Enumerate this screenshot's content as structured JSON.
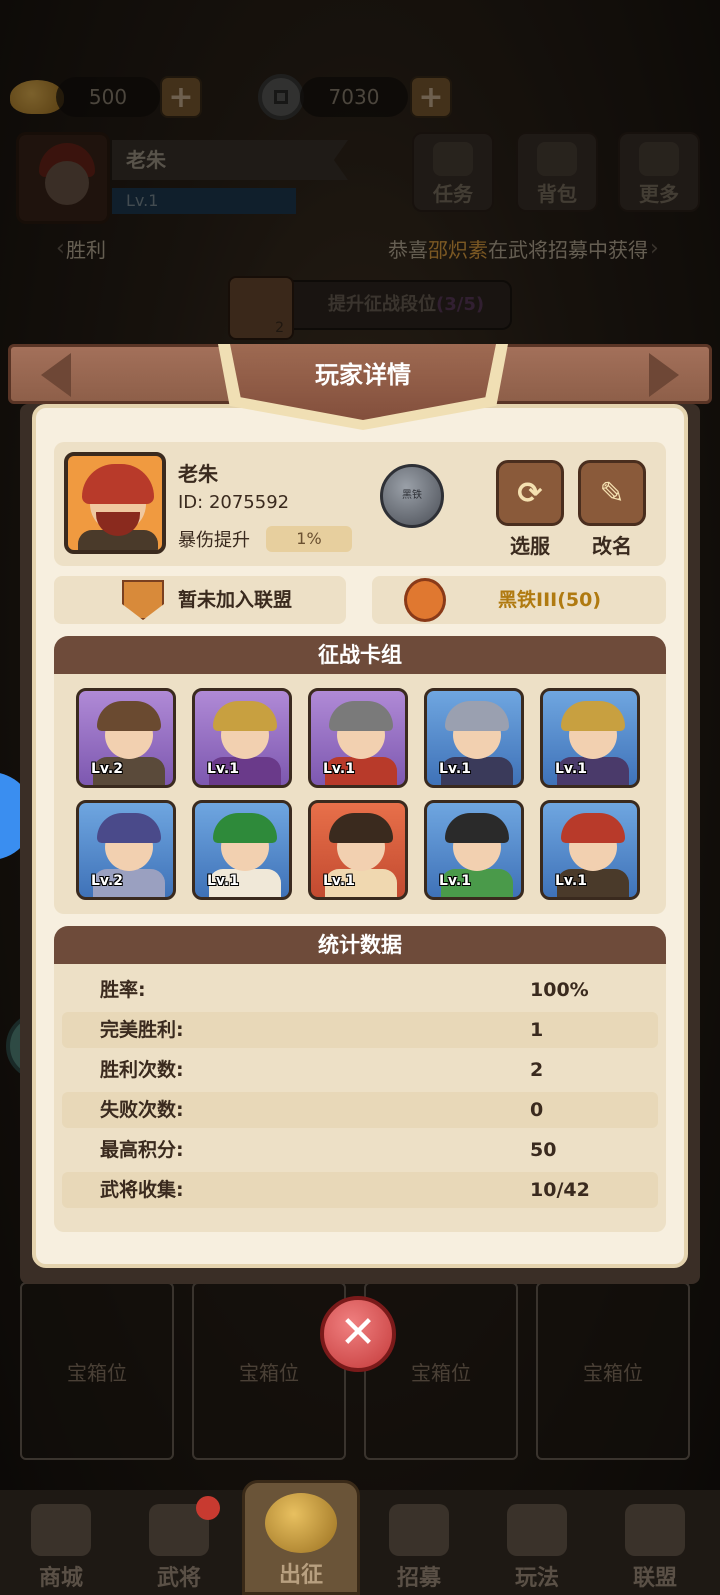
{
  "top_bar": {
    "gold_amount": "500",
    "coin_amount": "7030",
    "plus_label": "+"
  },
  "header": {
    "player_name": "老朱",
    "player_level": "Lv.1",
    "buttons": [
      {
        "label": "任务",
        "icon": "scroll-icon"
      },
      {
        "label": "背包",
        "icon": "bag-icon"
      },
      {
        "label": "更多",
        "icon": "menu-icon"
      }
    ]
  },
  "ticker": {
    "left_text": "胜利",
    "right_prefix": "恭喜",
    "right_name": "邵炽素",
    "right_suffix": "在武将招募中获得",
    "left_arrow": "‹",
    "right_arrow": "›"
  },
  "rank_button": {
    "label": "提升征战段位",
    "progress": "(3/5)",
    "count": "2"
  },
  "panel": {
    "title": "玩家详情",
    "player": {
      "name": "老朱",
      "id": "ID: 2075592",
      "crit_label": "暴伤提升",
      "crit_value": "1%",
      "rank_medal_text": "黑铁"
    },
    "actions": {
      "select_server": "选服",
      "rename": "改名"
    },
    "alliance": "暂未加入联盟",
    "rank": "黑铁III(50)",
    "deck": {
      "title": "征战卡组",
      "heroes": [
        {
          "level": "Lv.2",
          "color": "purple",
          "hair": "#6a4a30",
          "outfit": "#5a4a3a"
        },
        {
          "level": "Lv.1",
          "color": "purple",
          "hair": "#c8a040",
          "outfit": "#6a3a8a"
        },
        {
          "level": "Lv.1",
          "color": "purple",
          "hair": "#7a7a7a",
          "outfit": "#b83a2a"
        },
        {
          "level": "Lv.1",
          "color": "blue",
          "hair": "#9aa0b0",
          "outfit": "#3a3a5a"
        },
        {
          "level": "Lv.1",
          "color": "blue",
          "hair": "#c8a040",
          "outfit": "#4a3a6a"
        },
        {
          "level": "Lv.2",
          "color": "blue",
          "hair": "#4a4a8a",
          "outfit": "#9aa0c0"
        },
        {
          "level": "Lv.1",
          "color": "blue",
          "hair": "#2e8a3a",
          "outfit": "#f0e8d8"
        },
        {
          "level": "Lv.1",
          "color": "red",
          "hair": "#3a2a1e",
          "outfit": "#f0d8b0"
        },
        {
          "level": "Lv.1",
          "color": "blue",
          "hair": "#2a2a2a",
          "outfit": "#4a9a4a"
        },
        {
          "level": "Lv.1",
          "color": "blue",
          "hair": "#b83a2a",
          "outfit": "#4a3a2a"
        }
      ]
    },
    "stats": {
      "title": "统计数据",
      "rows": [
        {
          "label": "胜率:",
          "value": "100%"
        },
        {
          "label": "完美胜利:",
          "value": "1"
        },
        {
          "label": "胜利次数:",
          "value": "2"
        },
        {
          "label": "失败次数:",
          "value": "0"
        },
        {
          "label": "最高积分:",
          "value": "50"
        },
        {
          "label": "武将收集:",
          "value": "10/42"
        }
      ]
    },
    "close_label": "✕"
  },
  "chest_slots": [
    "宝箱位",
    "宝箱位",
    "宝箱位",
    "宝箱位"
  ],
  "bottom_nav": [
    {
      "label": "商城"
    },
    {
      "label": "武将"
    },
    {
      "label": "出征"
    },
    {
      "label": "招募"
    },
    {
      "label": "玩法"
    },
    {
      "label": "联盟"
    }
  ]
}
